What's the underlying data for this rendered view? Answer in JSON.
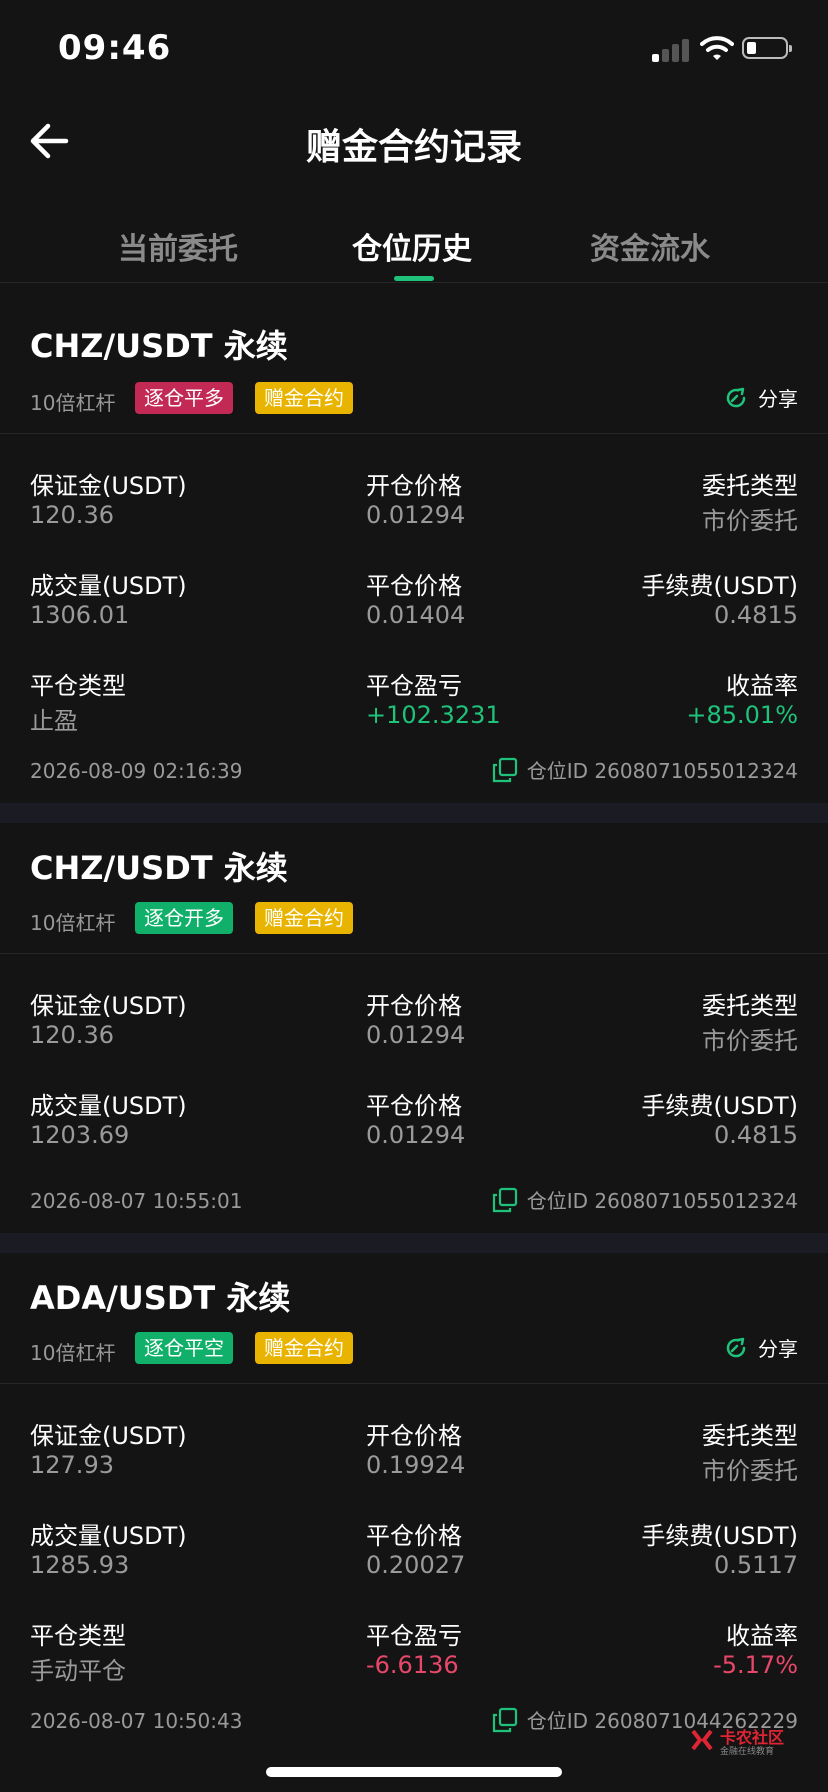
{
  "status_bar": {
    "time": "09:46"
  },
  "header": {
    "title": "赠金合约记录"
  },
  "tabs": [
    {
      "label": "当前委托",
      "active": false
    },
    {
      "label": "仓位历史",
      "active": true
    },
    {
      "label": "资金流水",
      "active": false
    }
  ],
  "colors": {
    "accent": "#1ec27a",
    "loss": "#e8476a",
    "tag_red": "#c22a55",
    "tag_green": "#10b06a",
    "tag_yellow": "#e9b400"
  },
  "cards": [
    {
      "pair": "CHZ/USDT 永续",
      "leverage": "10倍杠杆",
      "tag1": "逐仓平多",
      "tag2": "赠金合约",
      "share": "分享",
      "margin_label": "保证金(USDT)",
      "margin": "120.36",
      "open_price_label": "开仓价格",
      "open_price": "0.01294",
      "order_type_label": "委托类型",
      "order_type": "市价委托",
      "volume_label": "成交量(USDT)",
      "volume": "1306.01",
      "close_price_label": "平仓价格",
      "close_price": "0.01404",
      "fee_label": "手续费(USDT)",
      "fee": "0.4815",
      "close_type_label": "平仓类型",
      "close_type": "止盈",
      "pnl_label": "平仓盈亏",
      "pnl": "+102.3231",
      "roi_label": "收益率",
      "roi": "+85.01%",
      "time": "2026-08-09 02:16:39",
      "position_id": "仓位ID 2608071055012324"
    },
    {
      "pair": "CHZ/USDT 永续",
      "leverage": "10倍杠杆",
      "tag1": "逐仓开多",
      "tag2": "赠金合约",
      "margin_label": "保证金(USDT)",
      "margin": "120.36",
      "open_price_label": "开仓价格",
      "open_price": "0.01294",
      "order_type_label": "委托类型",
      "order_type": "市价委托",
      "volume_label": "成交量(USDT)",
      "volume": "1203.69",
      "close_price_label": "平仓价格",
      "close_price": "0.01294",
      "fee_label": "手续费(USDT)",
      "fee": "0.4815",
      "time": "2026-08-07 10:55:01",
      "position_id": "仓位ID 2608071055012324"
    },
    {
      "pair": "ADA/USDT 永续",
      "leverage": "10倍杠杆",
      "tag1": "逐仓平空",
      "tag2": "赠金合约",
      "share": "分享",
      "margin_label": "保证金(USDT)",
      "margin": "127.93",
      "open_price_label": "开仓价格",
      "open_price": "0.19924",
      "order_type_label": "委托类型",
      "order_type": "市价委托",
      "volume_label": "成交量(USDT)",
      "volume": "1285.93",
      "close_price_label": "平仓价格",
      "close_price": "0.20027",
      "fee_label": "手续费(USDT)",
      "fee": "0.5117",
      "close_type_label": "平仓类型",
      "close_type": "手动平仓",
      "pnl_label": "平仓盈亏",
      "pnl": "-6.6136",
      "roi_label": "收益率",
      "roi": "-5.17%",
      "time": "2026-08-07 10:50:43",
      "position_id": "仓位ID 2608071044262229"
    }
  ],
  "watermark": {
    "text": "卡农社区",
    "sub": "金融在线教育"
  }
}
